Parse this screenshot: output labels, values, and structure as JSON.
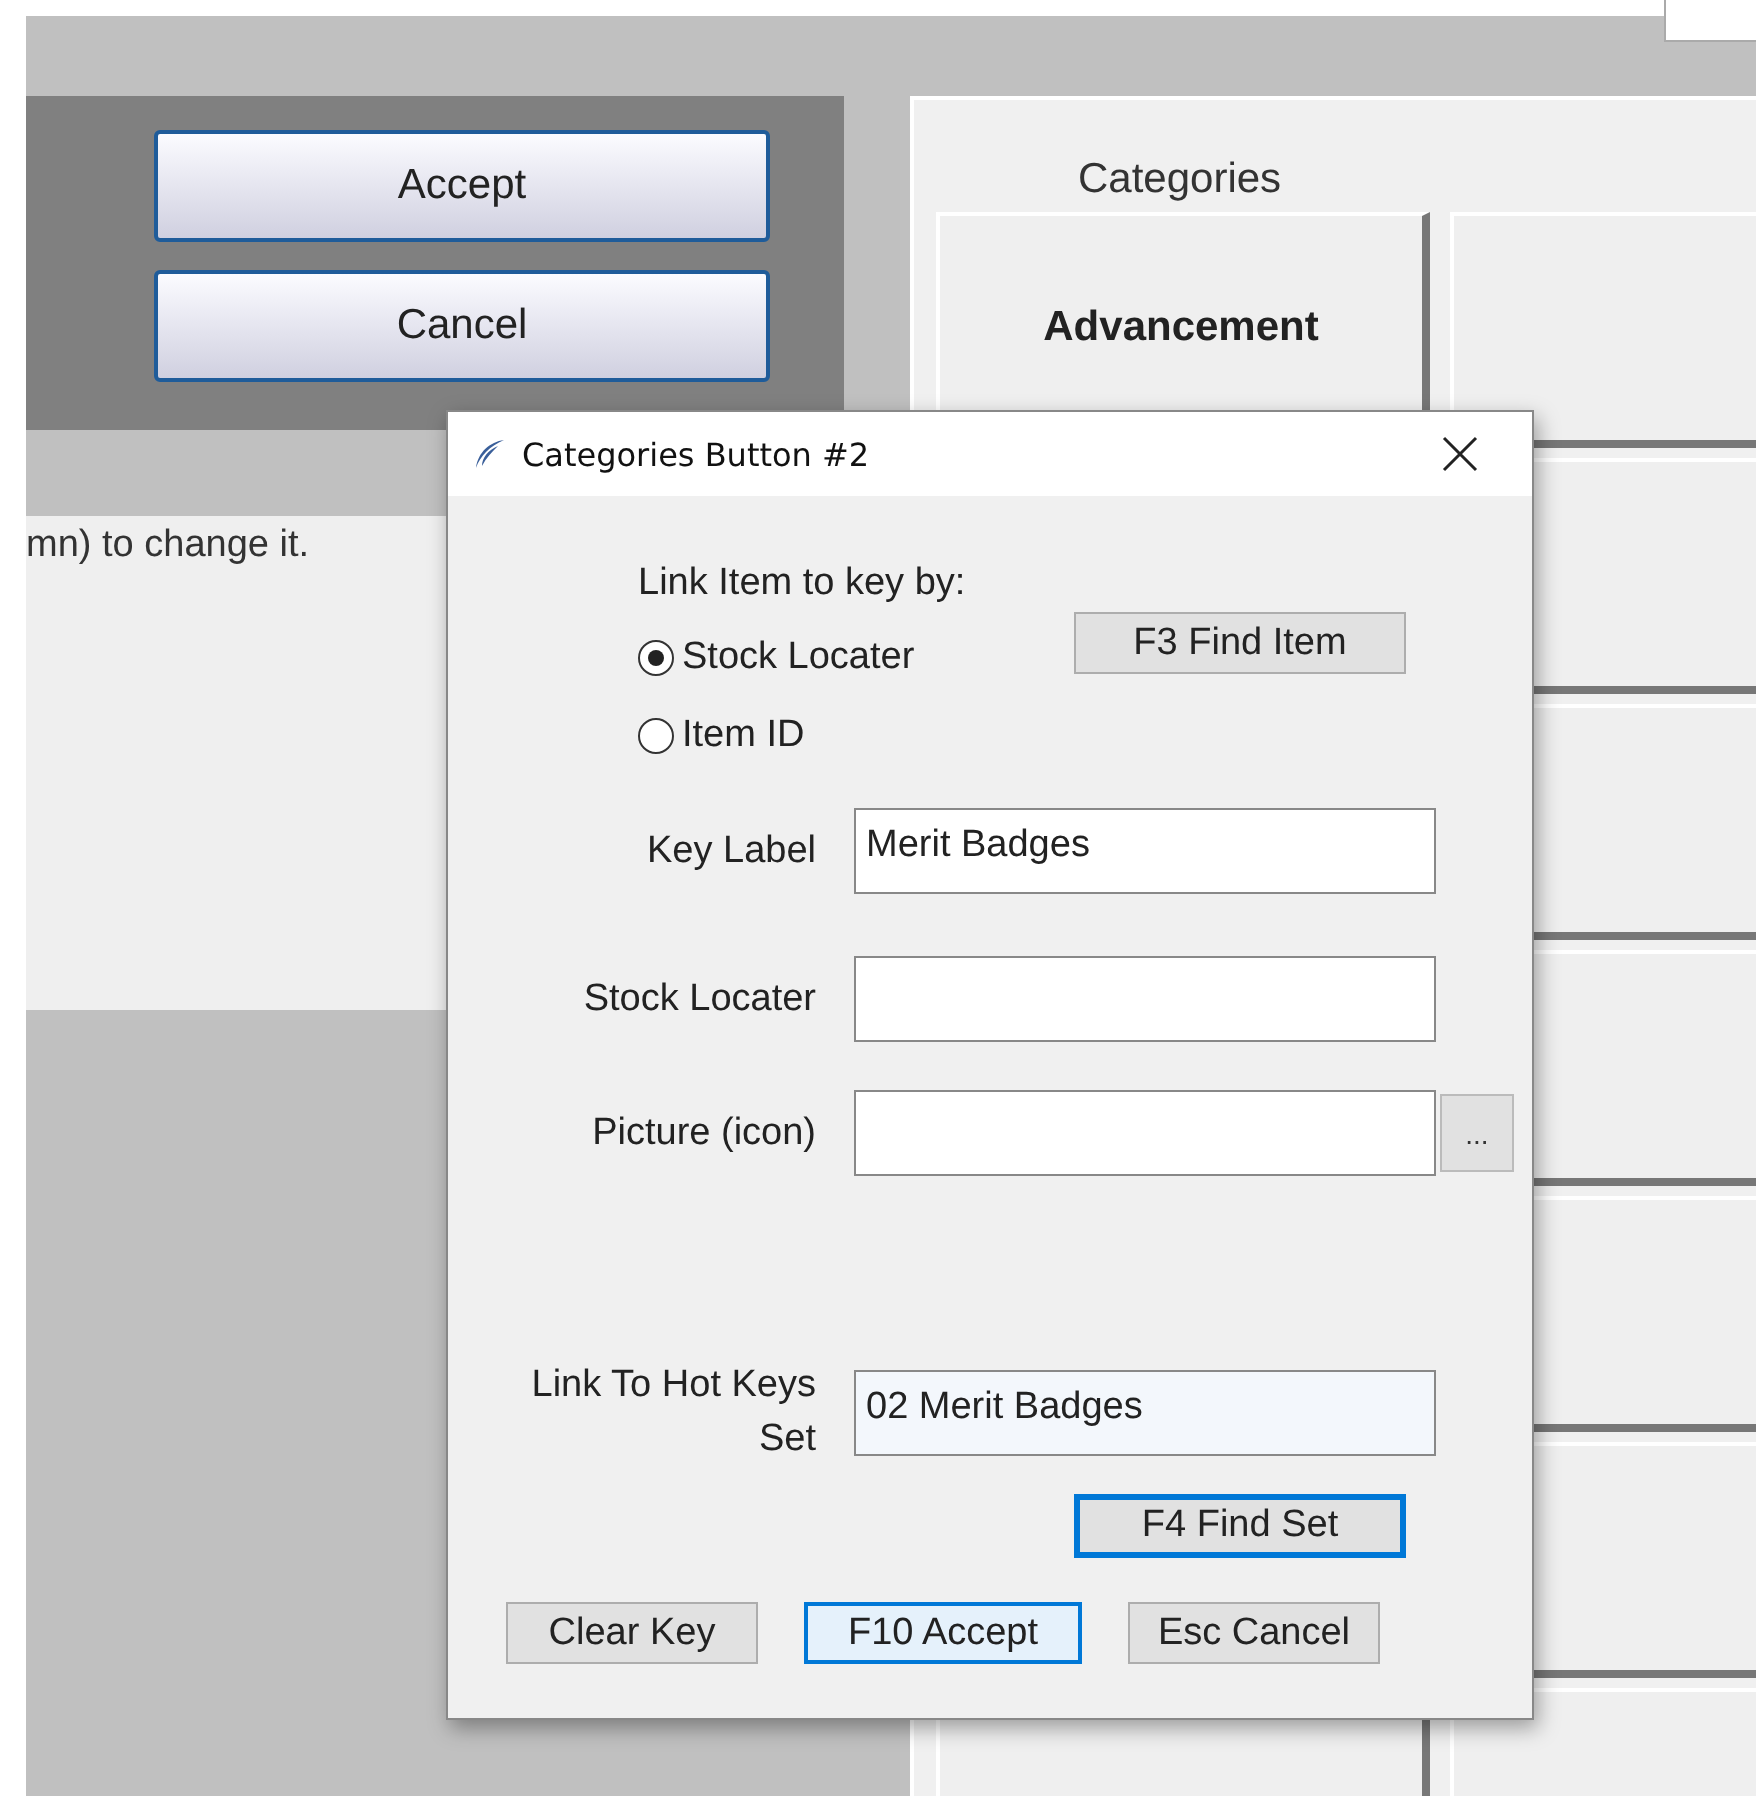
{
  "background": {
    "buttons": [
      {
        "label": "Accept"
      },
      {
        "label": "Cancel"
      }
    ],
    "hint_text": "mn) to change it.",
    "categories": {
      "title": "Categories",
      "tiles": [
        {
          "label": "Advancement"
        }
      ]
    }
  },
  "dialog": {
    "title": "Categories Button #2",
    "prompt": "Link Item to key by:",
    "radios": [
      {
        "label": "Stock Locater",
        "selected": true
      },
      {
        "label": "Item ID",
        "selected": false
      }
    ],
    "find_item_button": "F3 Find Item",
    "fields": [
      {
        "label": "Key Label",
        "value": "Merit Badges",
        "kind": "text"
      },
      {
        "label": "Stock Locater",
        "kind": "text"
      },
      {
        "label": "Picture (icon)",
        "kind": "browse",
        "browse_label": "..."
      }
    ],
    "hotkeys_field": {
      "label": "Link To Hot Keys Set",
      "value": "02 Merit Badges"
    },
    "find_set_button": {
      "label": "F4 Find Set",
      "focused": true
    },
    "buttons": [
      {
        "label": "Clear Key",
        "default": false
      },
      {
        "label": "F10 Accept",
        "default": true
      },
      {
        "label": "Esc Cancel",
        "default": false
      }
    ]
  }
}
